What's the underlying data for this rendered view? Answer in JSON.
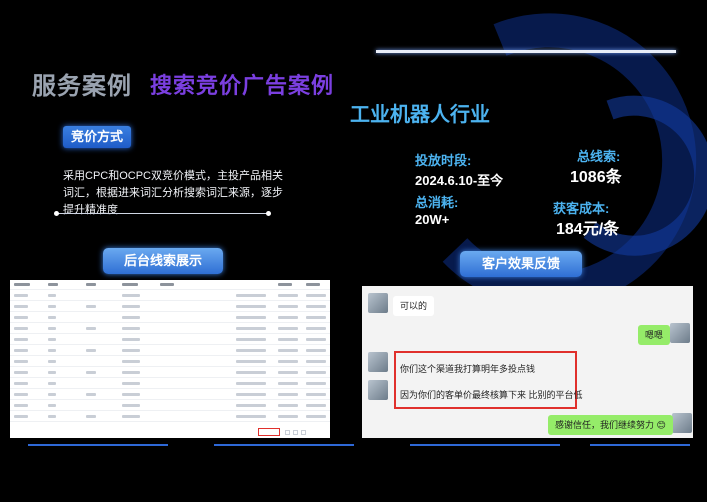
{
  "header": {
    "title": "服务案例",
    "subtitle": "搜索竞价广告案例",
    "industry": "工业机器人行业"
  },
  "method": {
    "tag": "竞价方式",
    "description": "采用CPC和OCPC双竞价模式，主投产品相关词汇，根据进来词汇分析搜索词汇来源，逐步提升精准度"
  },
  "stats": {
    "period_label": "投放时段:",
    "period_value": "2024.6.10-至今",
    "spend_label": "总消耗:",
    "spend_value": "20W+",
    "leads_label": "总线索:",
    "leads_value": "1086条",
    "cost_label": "获客成本:",
    "cost_value": "184元/条"
  },
  "sections": {
    "backend_label": "后台线索展示",
    "feedback_label": "客户效果反馈"
  },
  "chat": {
    "msg1": "可以的",
    "msg2": "嗯嗯",
    "msg3": "你们这个渠道我打算明年多投点钱",
    "msg4": "因为你们的客单价最终核算下来 比别的平台低",
    "msg5": "感谢信任，我们继续努力 😊"
  },
  "colors": {
    "accent_blue": "#4cb3f0",
    "accent_purple": "#7b3fe0",
    "highlight_red": "#e0302c",
    "chat_green": "#95ec69"
  }
}
